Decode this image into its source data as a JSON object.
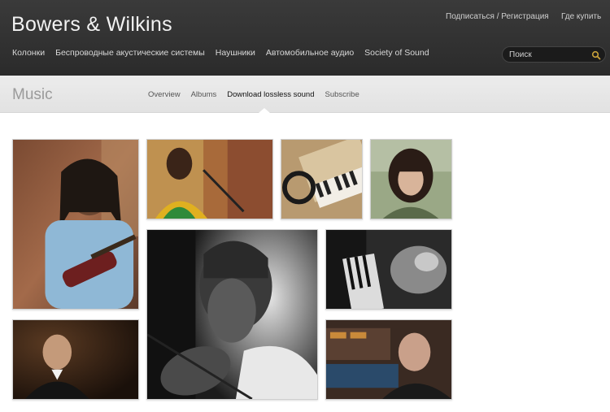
{
  "brand": {
    "logo_text": "Bowers & Wilkins"
  },
  "utility": {
    "register_label": "Подписаться / Регистрация",
    "where_to_buy_label": "Где купить"
  },
  "mainnav": {
    "items": [
      {
        "label": "Колонки"
      },
      {
        "label": "Беспроводные акустические системы"
      },
      {
        "label": "Наушники"
      },
      {
        "label": "Автомобильное аудио"
      },
      {
        "label": "Society of Sound"
      }
    ]
  },
  "search": {
    "placeholder": "Поиск",
    "icon": "search-icon"
  },
  "section": {
    "title": "Music",
    "tabs": [
      {
        "label": "Overview"
      },
      {
        "label": "Albums"
      },
      {
        "label": "Download lossless sound",
        "active": true
      },
      {
        "label": "Subscribe"
      }
    ]
  },
  "colors": {
    "header_bg": "#2f2f2f",
    "subbar_bg": "#e6e6e6",
    "search_icon": "#c9a23a"
  },
  "gallery": {
    "photos": [
      {
        "name": "guitarist-photo"
      },
      {
        "name": "singer-photo"
      },
      {
        "name": "keyboard-headphones-photo"
      },
      {
        "name": "woman-portrait-photo"
      },
      {
        "name": "violinist-photo"
      },
      {
        "name": "piano-studio-photo"
      },
      {
        "name": "conductor-photo"
      },
      {
        "name": "studio-man-photo"
      }
    ]
  }
}
